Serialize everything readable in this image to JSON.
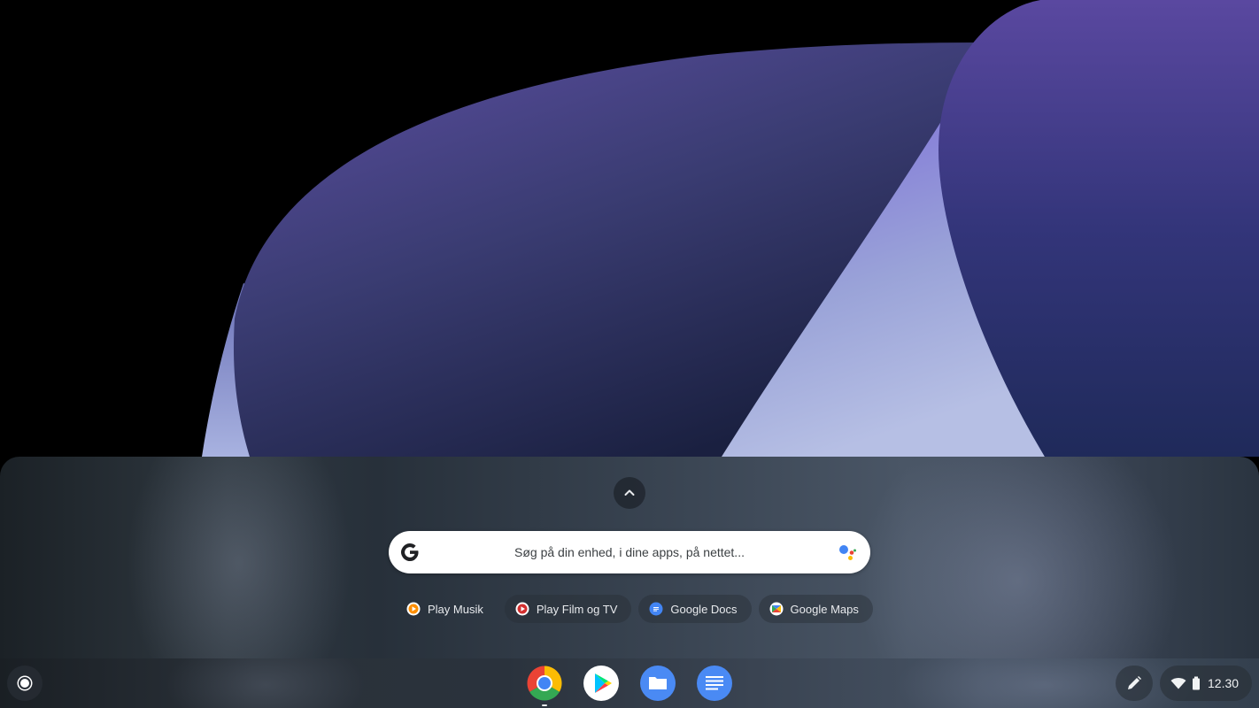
{
  "launcher": {
    "expand_icon": "chevron-up-icon",
    "search": {
      "placeholder": "Søg på din enhed, i dine apps, på nettet...",
      "left_icon": "google-g-icon",
      "right_icon": "google-assistant-icon"
    },
    "suggestions": [
      {
        "label": "Play Musik",
        "icon": "play-music-icon"
      },
      {
        "label": "Play Film og TV",
        "icon": "play-movies-icon"
      },
      {
        "label": "Google Docs",
        "icon": "google-docs-icon"
      },
      {
        "label": "Google Maps",
        "icon": "google-maps-icon"
      }
    ]
  },
  "shelf": {
    "apps": [
      {
        "name": "Chrome",
        "icon": "chrome-icon",
        "running": true
      },
      {
        "name": "Play Store",
        "icon": "play-store-icon",
        "running": false
      },
      {
        "name": "Files",
        "icon": "files-icon",
        "running": false
      },
      {
        "name": "Google Docs",
        "icon": "docs-icon",
        "running": false
      }
    ],
    "tray": {
      "stylus_icon": "stylus-icon",
      "wifi_icon": "wifi-icon",
      "battery_icon": "battery-icon",
      "time": "12.30"
    }
  },
  "colors": {
    "accent_blue": "#4285f4",
    "red": "#ea4335",
    "yellow": "#fbbc04",
    "green": "#34a853",
    "wallpaper_purple": "#5a4aa0"
  }
}
